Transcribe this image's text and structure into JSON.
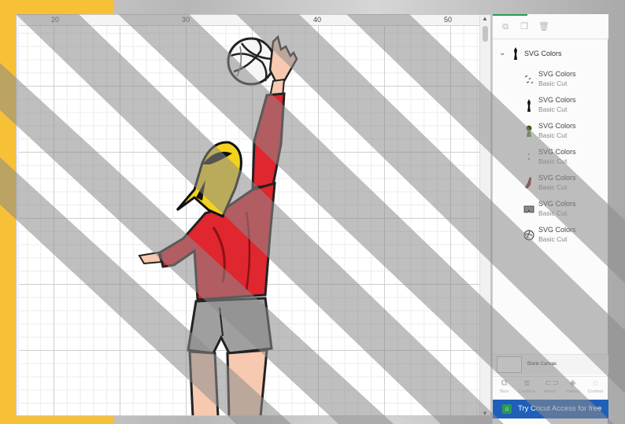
{
  "ruler": {
    "ticks": [
      "20",
      "30",
      "40",
      "50"
    ]
  },
  "layers_panel": {
    "group": {
      "label": "SVG Colors",
      "expanded": true
    },
    "layers": [
      {
        "title": "SVG Colors",
        "subtitle": "Basic Cut",
        "thumb": "scribble-icon",
        "color": "#555555"
      },
      {
        "title": "SVG Colors",
        "subtitle": "Basic Cut",
        "thumb": "figure-silhouette-icon",
        "color": "#111111"
      },
      {
        "title": "SVG Colors",
        "subtitle": "Basic Cut",
        "thumb": "hair-icon",
        "color": "#3b5d1a"
      },
      {
        "title": "SVG Colors",
        "subtitle": "Basic Cut",
        "thumb": "dots-icon",
        "color": "#6b6b6b"
      },
      {
        "title": "SVG Colors",
        "subtitle": "Basic Cut",
        "thumb": "shirt-icon",
        "color": "#8b1a1a"
      },
      {
        "title": "SVG Colors",
        "subtitle": "Basic Cut",
        "thumb": "shorts-icon",
        "color": "#777777"
      },
      {
        "title": "SVG Colors",
        "subtitle": "Basic Cut",
        "thumb": "volleyball-icon",
        "color": "#555555"
      }
    ],
    "blank_canvas_label": "Blank Canvas",
    "actions": [
      {
        "label": "Slice",
        "icon": "slice-icon"
      },
      {
        "label": "Combine",
        "icon": "combine-icon"
      },
      {
        "label": "Attach",
        "icon": "attach-icon"
      },
      {
        "label": "Flatten",
        "icon": "flatten-icon"
      },
      {
        "label": "Contour",
        "icon": "contour-icon"
      }
    ],
    "cta_label": "Try Cricut Access for free"
  },
  "colors": {
    "accent_green": "#2a9a54",
    "cta_blue": "#1f5fb8",
    "jersey_red": "#e0262f",
    "shorts_gray": "#9a9a9a",
    "hair_yellow": "#f2d21d",
    "frame_yellow": "#f7c137"
  }
}
